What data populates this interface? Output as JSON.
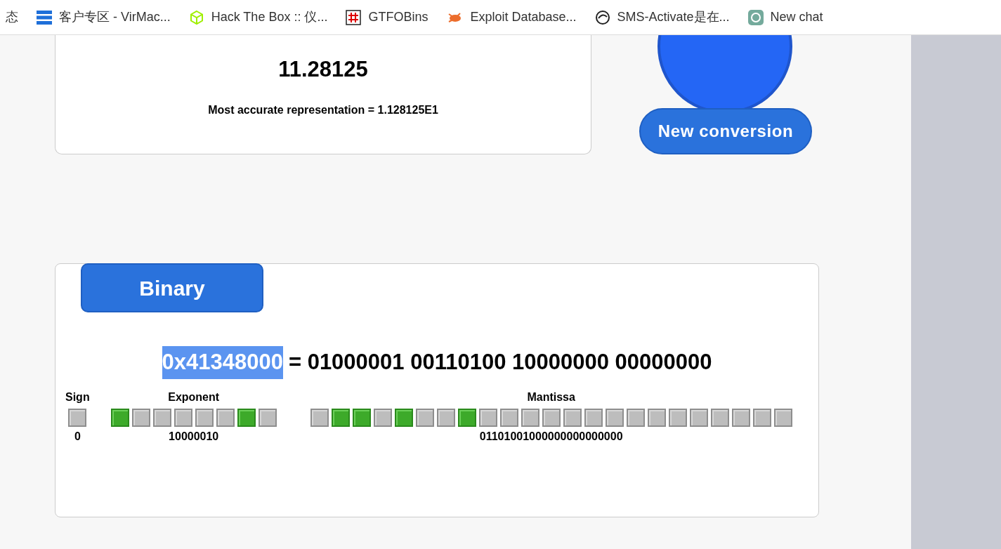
{
  "bookmarks": [
    {
      "label": "态"
    },
    {
      "label": "客户专区 - VirMac...",
      "kind": "server"
    },
    {
      "label": "Hack The Box :: 仪...",
      "kind": "cube"
    },
    {
      "label": "GTFOBins",
      "kind": "hash"
    },
    {
      "label": "Exploit Database...",
      "kind": "bug"
    },
    {
      "label": "SMS-Activate是在...",
      "kind": "circle"
    },
    {
      "label": "New chat",
      "kind": "chat"
    }
  ],
  "result": {
    "value": "11.28125",
    "representation": "Most accurate representation = 1.128125E1"
  },
  "new_conversion_button": "New conversion",
  "binary": {
    "tab": "Binary",
    "hex": "0x41348000",
    "hex_selected": true,
    "equals": "= 01000001 00110100 10000000 00000000",
    "groups": [
      {
        "title": "Sign",
        "value": "0",
        "bits": [
          false
        ]
      },
      {
        "title": "Exponent",
        "value": "10000010",
        "bits": [
          true,
          false,
          false,
          false,
          false,
          false,
          true,
          false
        ]
      },
      {
        "title": "Mantissa",
        "value": "01101001000000000000000",
        "bits": [
          false,
          true,
          true,
          false,
          true,
          false,
          false,
          true,
          false,
          false,
          false,
          false,
          false,
          false,
          false,
          false,
          false,
          false,
          false,
          false,
          false,
          false,
          false
        ]
      }
    ]
  }
}
